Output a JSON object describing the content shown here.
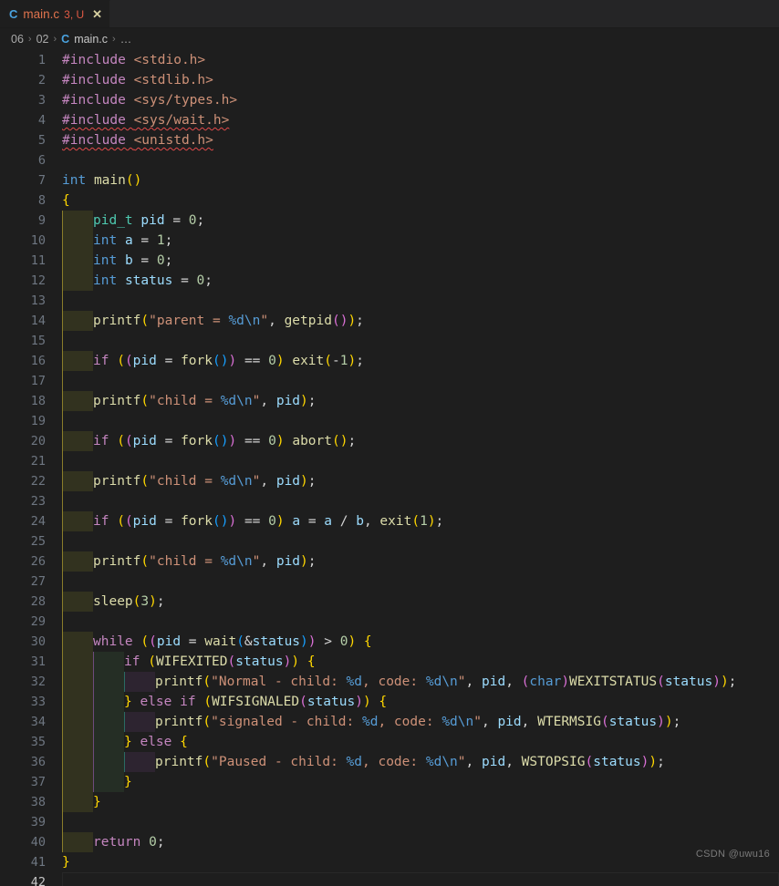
{
  "window": {
    "background": "#1e1e1e"
  },
  "tab": {
    "file_icon": "c-file-icon",
    "icon_letter": "C",
    "name": "main.c",
    "badge": "3, U",
    "close_glyph": "✕"
  },
  "breadcrumb": {
    "items": [
      "06",
      "02",
      "main.c",
      "…"
    ],
    "separator": "›",
    "file_icon_letter": "C"
  },
  "editor": {
    "active_line": 42,
    "total_visible_lines": 42,
    "tab_size": 4,
    "colors": {
      "background": "#1e1e1e",
      "line_number": "#6e7681",
      "line_number_active": "#c6c6c6",
      "keyword": "#569cd6",
      "control": "#c586c0",
      "type": "#4ec9b0",
      "function": "#dcdcaa",
      "variable": "#9cdcfe",
      "string": "#ce9178",
      "escape": "#569cd6",
      "number": "#b5cea8",
      "operator": "#d4d4d4",
      "bracket1": "#ffd700",
      "bracket2": "#da70d6",
      "bracket3": "#179fff",
      "error_squiggle": "#e04a4a",
      "indent_block_1": "#32321f",
      "indent_block_2": "#252e25",
      "indent_block_3": "#2d2430"
    },
    "lines": [
      {
        "n": 1,
        "text": "#include <stdio.h>"
      },
      {
        "n": 2,
        "text": "#include <stdlib.h>"
      },
      {
        "n": 3,
        "text": "#include <sys/types.h>"
      },
      {
        "n": 4,
        "text": "#include <sys/wait.h>",
        "error": true
      },
      {
        "n": 5,
        "text": "#include <unistd.h>",
        "error": true
      },
      {
        "n": 6,
        "text": ""
      },
      {
        "n": 7,
        "text": "int main()"
      },
      {
        "n": 8,
        "text": "{"
      },
      {
        "n": 9,
        "text": "    pid_t pid = 0;"
      },
      {
        "n": 10,
        "text": "    int a = 1;"
      },
      {
        "n": 11,
        "text": "    int b = 0;"
      },
      {
        "n": 12,
        "text": "    int status = 0;"
      },
      {
        "n": 13,
        "text": ""
      },
      {
        "n": 14,
        "text": "    printf(\"parent = %d\\n\", getpid());"
      },
      {
        "n": 15,
        "text": ""
      },
      {
        "n": 16,
        "text": "    if ((pid = fork()) == 0) exit(-1);"
      },
      {
        "n": 17,
        "text": ""
      },
      {
        "n": 18,
        "text": "    printf(\"child = %d\\n\", pid);"
      },
      {
        "n": 19,
        "text": ""
      },
      {
        "n": 20,
        "text": "    if ((pid = fork()) == 0) abort();"
      },
      {
        "n": 21,
        "text": ""
      },
      {
        "n": 22,
        "text": "    printf(\"child = %d\\n\", pid);"
      },
      {
        "n": 23,
        "text": ""
      },
      {
        "n": 24,
        "text": "    if ((pid = fork()) == 0) a = a / b, exit(1);"
      },
      {
        "n": 25,
        "text": ""
      },
      {
        "n": 26,
        "text": "    printf(\"child = %d\\n\", pid);"
      },
      {
        "n": 27,
        "text": ""
      },
      {
        "n": 28,
        "text": "    sleep(3);"
      },
      {
        "n": 29,
        "text": ""
      },
      {
        "n": 30,
        "text": "    while ((pid = wait(&status)) > 0) {"
      },
      {
        "n": 31,
        "text": "        if (WIFEXITED(status)) {"
      },
      {
        "n": 32,
        "text": "            printf(\"Normal - child: %d, code: %d\\n\", pid, (char)WEXITSTATUS(status));"
      },
      {
        "n": 33,
        "text": "        } else if (WIFSIGNALED(status)) {"
      },
      {
        "n": 34,
        "text": "            printf(\"signaled - child: %d, code: %d\\n\", pid, WTERMSIG(status));"
      },
      {
        "n": 35,
        "text": "        } else {"
      },
      {
        "n": 36,
        "text": "            printf(\"Paused - child: %d, code: %d\\n\", pid, WSTOPSIG(status));"
      },
      {
        "n": 37,
        "text": "        }"
      },
      {
        "n": 38,
        "text": "    }"
      },
      {
        "n": 39,
        "text": ""
      },
      {
        "n": 40,
        "text": "    return 0;"
      },
      {
        "n": 41,
        "text": "}"
      },
      {
        "n": 42,
        "text": ""
      }
    ]
  },
  "watermark": {
    "text": "CSDN @uwu16"
  }
}
